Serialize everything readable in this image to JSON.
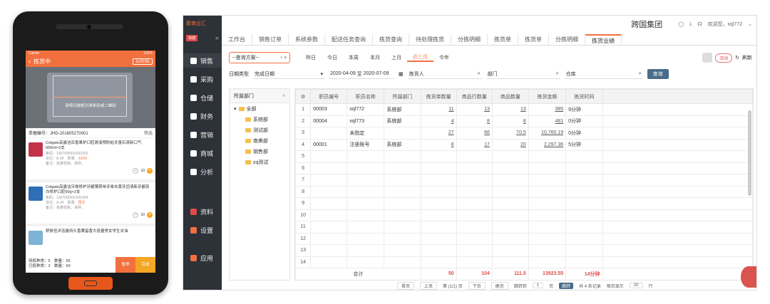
{
  "phone": {
    "status": {
      "carrier": "Carrier",
      "battery": "100%"
    },
    "title": "拣货中",
    "close_label": "关闭扫码",
    "scan_hint": "请将扫描框对准条码或二维码",
    "order_label": "单据编号：JHD-201805270001",
    "filter_label": "筛选",
    "items": [
      {
        "name": "Colgate高露洁百香果护口腔漱液预防蛀牙香石清新口气500ml×2支",
        "code": "条码：1307090591991000",
        "loc": "货位：A-39",
        "qty_label": "数量：",
        "qty": "100/6",
        "note": "备注：批量轻拣，易碎。",
        "count": "10"
      },
      {
        "name": "Colgate高露洁牙膏修护牙龈薄荷味牙膏去黄牙齿清新牙龈亮白修护口腔90g×2支",
        "code": "条码：1307090591991004",
        "loc": "货位：A-34",
        "qty_label": "数量：",
        "qty": "再次",
        "note": "备注：批量轻拣，易碎。",
        "count": "10"
      },
      {
        "name": "舒肤佳沐浴露持久香薰留香大容量男女学生去油",
        "code": "",
        "loc": "",
        "qty_label": "",
        "qty": "",
        "note": "",
        "count": ""
      }
    ],
    "summary": {
      "line1": "待拣种类：5　数量：95",
      "line2": "已拣种类：3　数量：60"
    },
    "btn_pause": "暂停",
    "btn_done": "完成"
  },
  "desk": {
    "logo": "聚商企汇",
    "tag": "快捷",
    "nav": [
      "销售",
      "采购",
      "仓储",
      "财务",
      "营销",
      "商城",
      "分析",
      "资料",
      "设置",
      "应用"
    ],
    "org": "跨国集团",
    "user": "欢迎您，xql772",
    "tabs": [
      "工作台",
      "销售订单",
      "系统参数",
      "配送任务查询",
      "拣货查询",
      "待处理拣货",
      "分拣明细",
      "拣货单",
      "拣货单",
      "分拣明细",
      "拣货业绩"
    ],
    "plan_label": "--查询方案--",
    "quick": [
      "昨日",
      "今日",
      "本周",
      "本月",
      "上月",
      "近三月",
      "今年"
    ],
    "quick_selected": 5,
    "hd_label": "活动",
    "refresh_label": "刷新",
    "filters": {
      "date_type": "日期类型",
      "date_kind": "完成日期",
      "date_from": "2020-04-09",
      "to": "至",
      "date_to": "2020-07-09",
      "picker": "拣货人",
      "dept": "部门",
      "warehouse": "仓库",
      "query": "查询"
    },
    "tree_title": "所属部门",
    "tree": [
      "全部",
      "系统部",
      "测试部",
      "南美部",
      "销售部",
      "zq测试"
    ],
    "columns": [
      "职员编号",
      "职员名称",
      "所属部门",
      "拣货单数量",
      "商品行数量",
      "商品数量",
      "拣货金额",
      "拣货时间"
    ],
    "rows": [
      [
        "1",
        "00003",
        "xql772",
        "系统部",
        "11",
        "13",
        "13",
        "385",
        "9分钟"
      ],
      [
        "2",
        "00004",
        "xql773",
        "系统部",
        "4",
        "8",
        "8",
        "481",
        "0分钟"
      ],
      [
        "3",
        "",
        "未指定",
        "",
        "27",
        "66",
        "70.5",
        "10,760.19",
        "0分钟"
      ],
      [
        "4",
        "00001",
        "注册账号",
        "系统部",
        "8",
        "17",
        "20",
        "2,297.36",
        "5分钟"
      ],
      [
        "5",
        "",
        "",
        "",
        "",
        "",
        "",
        "",
        ""
      ],
      [
        "6",
        "",
        "",
        "",
        "",
        "",
        "",
        "",
        ""
      ],
      [
        "7",
        "",
        "",
        "",
        "",
        "",
        "",
        "",
        ""
      ],
      [
        "8",
        "",
        "",
        "",
        "",
        "",
        "",
        "",
        ""
      ],
      [
        "9",
        "",
        "",
        "",
        "",
        "",
        "",
        "",
        ""
      ],
      [
        "10",
        "",
        "",
        "",
        "",
        "",
        "",
        "",
        ""
      ],
      [
        "11",
        "",
        "",
        "",
        "",
        "",
        "",
        "",
        ""
      ],
      [
        "12",
        "",
        "",
        "",
        "",
        "",
        "",
        "",
        ""
      ],
      [
        "13",
        "",
        "",
        "",
        "",
        "",
        "",
        "",
        ""
      ],
      [
        "14",
        "",
        "",
        "",
        "",
        "",
        "",
        "",
        ""
      ]
    ],
    "total": {
      "label": "合计",
      "values": [
        "50",
        "104",
        "111.5",
        "13923.55",
        "14分钟"
      ]
    },
    "pager": {
      "first": "首页",
      "prev": "上页",
      "page": "第 (1/1) 页",
      "next": "下页",
      "last": "尾页",
      "jump": "跳转到",
      "jump_val": "1",
      "jump_unit": "页",
      "go": "跳转",
      "count": "共 4 条记录",
      "per_page": "每页显示",
      "per_val": "20",
      "per_unit": "行"
    }
  }
}
